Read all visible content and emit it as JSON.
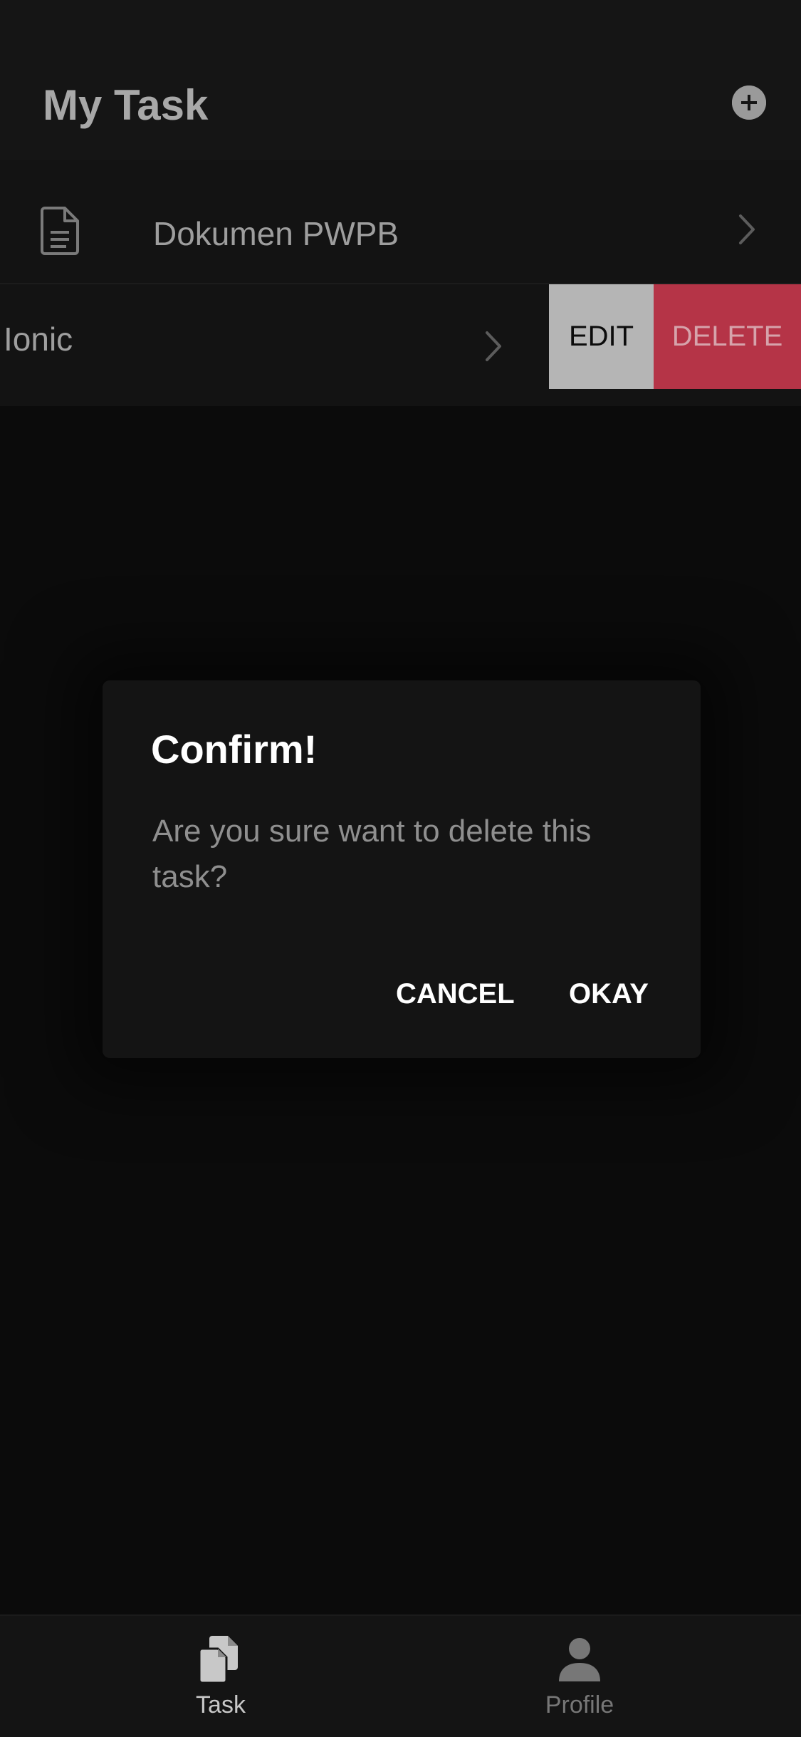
{
  "header": {
    "title": "My Task",
    "add_icon": "plus-circle-icon"
  },
  "tasks": [
    {
      "label": "Dokumen PWPB",
      "icon": "document-icon"
    },
    {
      "label": "Ionic"
    }
  ],
  "swipe_options": {
    "edit_label": "EDIT",
    "delete_label": "DELETE"
  },
  "dialog": {
    "title": "Confirm!",
    "message": "Are you sure want to delete this task?",
    "cancel_label": "CANCEL",
    "okay_label": "OKAY"
  },
  "tabs": [
    {
      "label": "Task",
      "icon": "documents-icon",
      "selected": true
    },
    {
      "label": "Profile",
      "icon": "person-icon",
      "selected": false
    }
  ],
  "colors": {
    "background": "#0b0b0b",
    "delete": "#b53447",
    "edit": "#b5b5b5",
    "active_tab": "#c8c8c8",
    "inactive_tab": "#777777"
  }
}
